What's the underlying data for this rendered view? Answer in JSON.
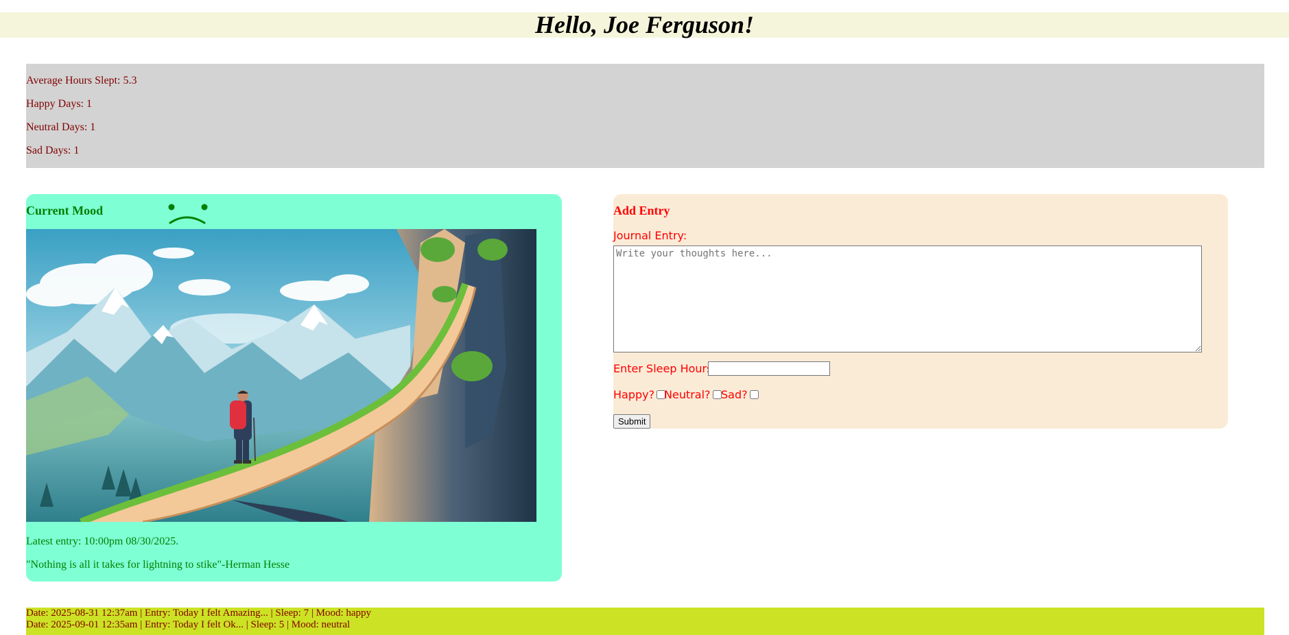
{
  "header": {
    "greeting": "Hello, Joe Ferguson!"
  },
  "stats": {
    "average_sleep": "Average Hours Slept: 5.3",
    "happy_days": "Happy Days: 1",
    "neutral_days": "Neutral Days: 1",
    "sad_days": "Sad Days: 1"
  },
  "mood_panel": {
    "title": "Current Mood",
    "mood_icon": "sad-face-icon",
    "latest_entry": "Latest entry: 10:00pm 08/30/2025.",
    "quote": "\"Nothing is all it takes for lightning to stike\"-Herman Hesse"
  },
  "entry_form": {
    "title": "Add Entry",
    "journal_label": "Journal Entry:",
    "journal_placeholder": "Write your thoughts here...",
    "journal_value": "",
    "sleep_label": "Enter Sleep Hours:",
    "sleep_value": "",
    "happy_label": "Happy?",
    "neutral_label": "Neutral?",
    "sad_label": "Sad?",
    "submit_label": "Submit"
  },
  "history": {
    "entries": [
      "Date: 2025-08-31 12:37am | Entry: Today I felt Amazing... | Sleep: 7 | Mood: happy",
      "Date: 2025-09-01 12:35am | Entry: Today I felt Ok... | Sleep: 5 | Mood: neutral"
    ]
  },
  "colors": {
    "header_bg": "#f5f5dc",
    "stats_bg": "#d3d3d3",
    "stats_text": "#800000",
    "mood_bg": "#7fffd4",
    "mood_text": "#008000",
    "entry_bg": "#faebd7",
    "entry_text": "#ff0000",
    "history_bg": "#cce224"
  }
}
